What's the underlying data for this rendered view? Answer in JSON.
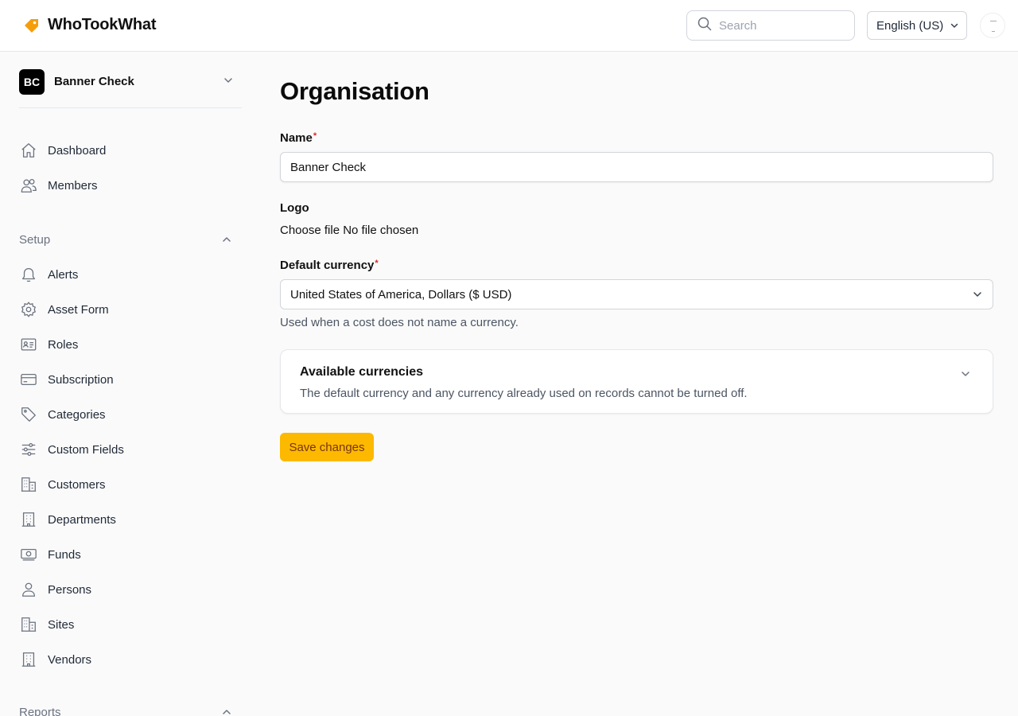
{
  "header": {
    "app_name": "WhoTookWhat",
    "search_placeholder": "Search",
    "language": "English (US)",
    "logo_color": "#f59e0b"
  },
  "sidebar": {
    "org": {
      "initials": "BC",
      "name": "Banner Check"
    },
    "main_items": [
      {
        "label": "Dashboard",
        "icon": "home-icon"
      },
      {
        "label": "Members",
        "icon": "users-icon"
      }
    ],
    "setup": {
      "title": "Setup",
      "items": [
        {
          "label": "Alerts",
          "icon": "bell-icon"
        },
        {
          "label": "Asset Form",
          "icon": "gear-icon"
        },
        {
          "label": "Roles",
          "icon": "id-card-icon"
        },
        {
          "label": "Subscription",
          "icon": "credit-card-icon"
        },
        {
          "label": "Categories",
          "icon": "tag-icon"
        },
        {
          "label": "Custom Fields",
          "icon": "sliders-icon"
        },
        {
          "label": "Customers",
          "icon": "building-icon"
        },
        {
          "label": "Departments",
          "icon": "office-building-icon"
        },
        {
          "label": "Funds",
          "icon": "banknote-icon"
        },
        {
          "label": "Persons",
          "icon": "person-icon"
        },
        {
          "label": "Sites",
          "icon": "building-icon"
        },
        {
          "label": "Vendors",
          "icon": "office-building-icon"
        }
      ]
    },
    "reports": {
      "title": "Reports"
    }
  },
  "main": {
    "title": "Organisation",
    "name_label": "Name",
    "name_value": "Banner Check",
    "logo_label": "Logo",
    "file_button": "Choose file",
    "file_status": "No file chosen",
    "currency_label": "Default currency",
    "currency_value": "United States of America, Dollars ($ USD)",
    "currency_help": "Used when a cost does not name a currency.",
    "available": {
      "title": "Available currencies",
      "description": "The default currency and any currency already used on records cannot be turned off."
    },
    "save_label": "Save changes",
    "required_marker": "*",
    "accent_color": "#fcb900"
  }
}
